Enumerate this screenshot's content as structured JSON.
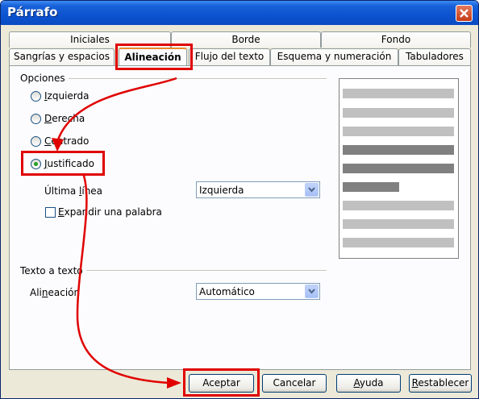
{
  "window": {
    "title": "Párrafo"
  },
  "tabs": {
    "row1": [
      "Iniciales",
      "Borde",
      "Fondo"
    ],
    "row2": [
      "Sangrías y espacios",
      "Alineación",
      "Flujo del texto",
      "Esquema y numeración",
      "Tabuladores"
    ],
    "active": "Alineación"
  },
  "options": {
    "label": "Opciones",
    "radios": [
      {
        "label": "Izquierda",
        "selected": false
      },
      {
        "label": "Derecha",
        "selected": false
      },
      {
        "label": "Centrado",
        "selected": false
      },
      {
        "label": "Justificado",
        "selected": true
      }
    ],
    "last_line_label": "Última línea",
    "last_line_value": "Izquierda",
    "expand_label": "Expandir una palabra",
    "expand_checked": false
  },
  "text_to_text": {
    "label": "Texto a texto",
    "alignment_label": "Alineación",
    "alignment_value": "Automático"
  },
  "buttons": {
    "ok": "Aceptar",
    "cancel": "Cancelar",
    "help": "Ayuda",
    "reset": "Restablecer"
  },
  "colors": {
    "highlight": "#e00000",
    "selected_radio": "#21a121"
  },
  "preview_lines": [
    "light",
    "light",
    "light",
    "dark",
    "dark",
    "dark-short",
    "light",
    "light",
    "light"
  ]
}
